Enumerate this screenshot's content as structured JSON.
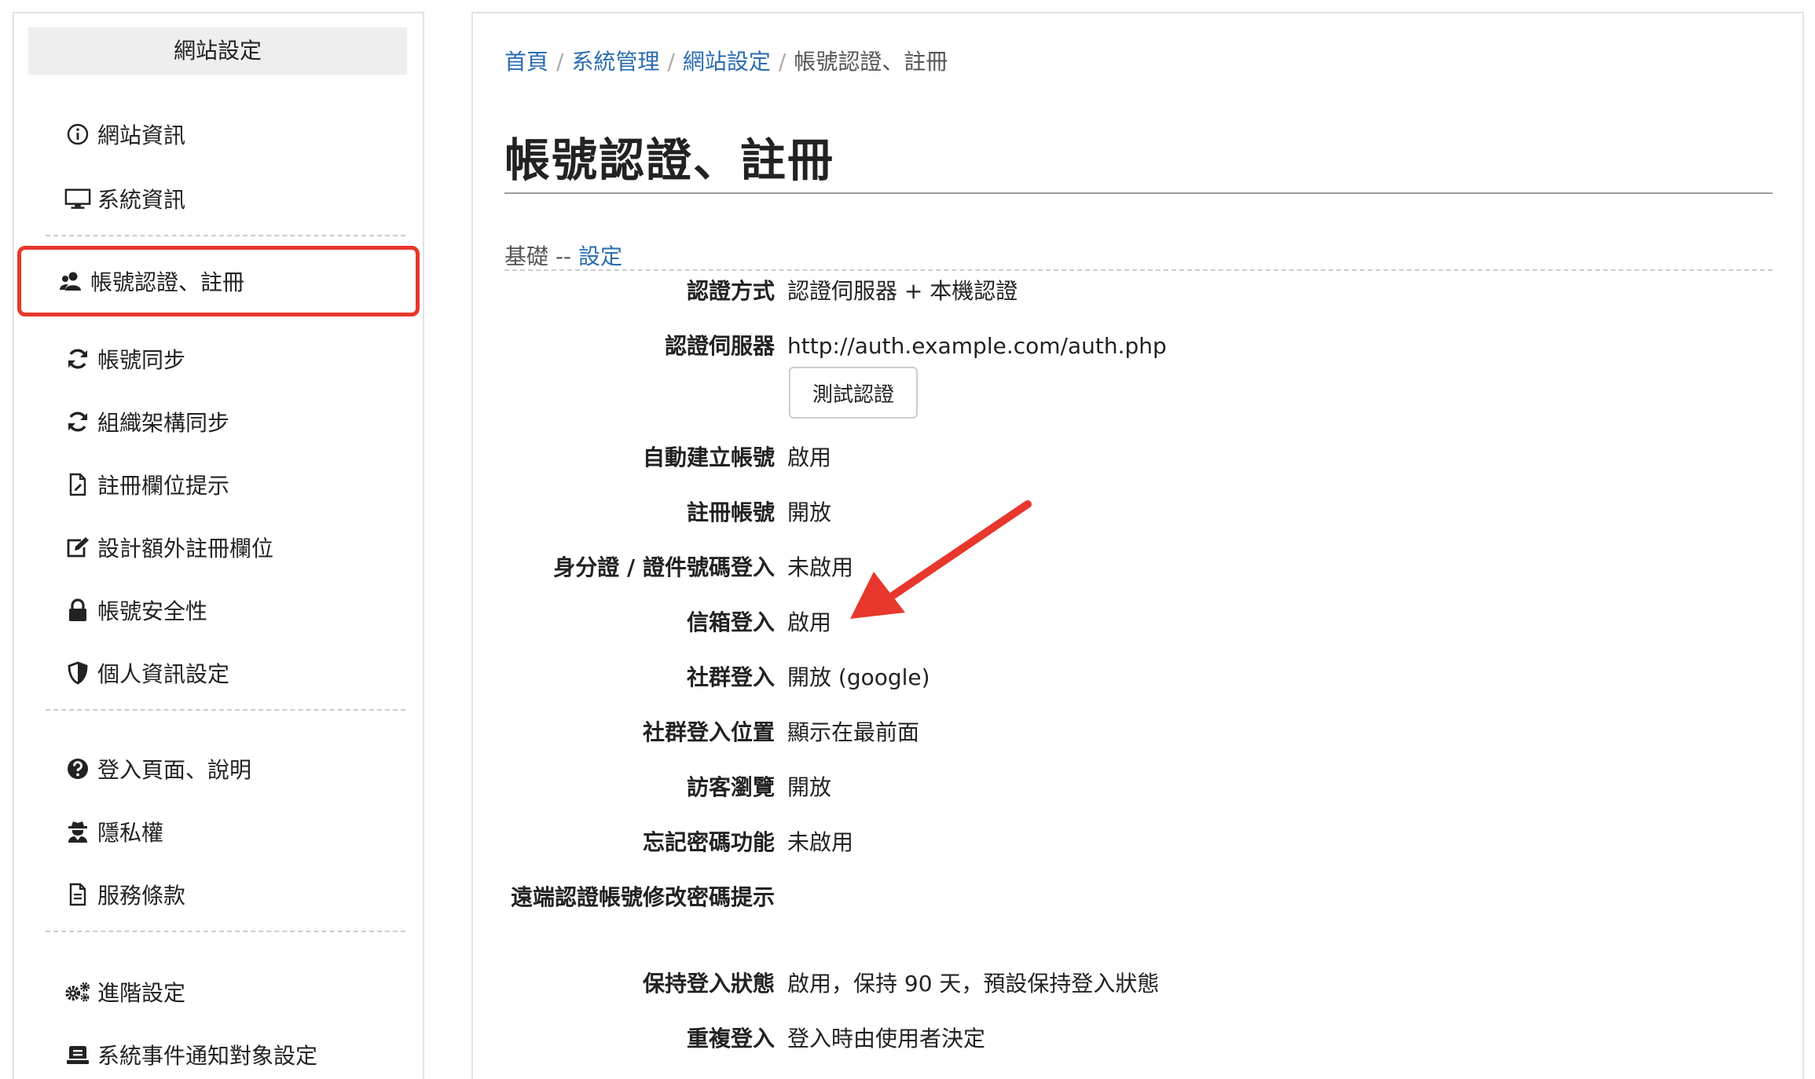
{
  "sidebar": {
    "header": "網站設定",
    "items": [
      {
        "label": "網站資訊",
        "icon": "info-circle-icon"
      },
      {
        "label": "系統資訊",
        "icon": "monitor-icon"
      },
      {
        "label": "帳號認證、註冊",
        "icon": "users-icon"
      },
      {
        "label": "帳號同步",
        "icon": "sync-icon"
      },
      {
        "label": "組織架構同步",
        "icon": "sync-icon"
      },
      {
        "label": "註冊欄位提示",
        "icon": "file-icon"
      },
      {
        "label": "設計額外註冊欄位",
        "icon": "edit-icon"
      },
      {
        "label": "帳號安全性",
        "icon": "lock-icon"
      },
      {
        "label": "個人資訊設定",
        "icon": "shield-icon"
      },
      {
        "label": "登入頁面、說明",
        "icon": "question-circle-icon"
      },
      {
        "label": "隱私權",
        "icon": "user-secret-icon"
      },
      {
        "label": "服務條款",
        "icon": "file-text-icon"
      },
      {
        "label": "進階設定",
        "icon": "gears-icon"
      },
      {
        "label": "系統事件通知對象設定",
        "icon": "notification-icon"
      }
    ]
  },
  "breadcrumb": {
    "home": "首頁",
    "system": "系統管理",
    "site": "網站設定",
    "current": "帳號認證、註冊",
    "separator": "/"
  },
  "page": {
    "title": "帳號認證、註冊",
    "section_prefix": "基礎 --",
    "section_link": "設定"
  },
  "settings": [
    {
      "key": "認證方式",
      "value": "認證伺服器 + 本機認證"
    },
    {
      "key": "認證伺服器",
      "value": "http://auth.example.com/auth.php"
    },
    {
      "key": "自動建立帳號",
      "value": "啟用"
    },
    {
      "key": "註冊帳號",
      "value": "開放"
    },
    {
      "key": "身分證 / 證件號碼登入",
      "value": "未啟用"
    },
    {
      "key": "信箱登入",
      "value": "啟用"
    },
    {
      "key": "社群登入",
      "value": "開放 (google)"
    },
    {
      "key": "社群登入位置",
      "value": "顯示在最前面"
    },
    {
      "key": "訪客瀏覽",
      "value": "開放"
    },
    {
      "key": "忘記密碼功能",
      "value": "未啟用"
    },
    {
      "key": "遠端認證帳號修改密碼提示",
      "value": ""
    },
    {
      "key": "保持登入狀態",
      "value": "啟用，保持 90 天，預設保持登入狀態"
    },
    {
      "key": "重複登入",
      "value": "登入時由使用者決定"
    }
  ],
  "test_button": "測試認證",
  "colors": {
    "link": "#2b6cb0",
    "highlight": "#e8372c",
    "arrow": "#e8372c"
  }
}
